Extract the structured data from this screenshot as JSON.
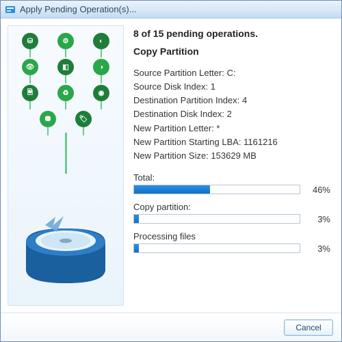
{
  "window": {
    "title": "Apply Pending Operation(s)..."
  },
  "operation": {
    "header": "8 of 15 pending operations.",
    "name": "Copy Partition",
    "details": {
      "source_partition_letter": "Source Partition Letter: C:",
      "source_disk_index": "Source Disk Index: 1",
      "destination_partition_index": "Destination Partition Index: 4",
      "destination_disk_index": "Destination Disk Index: 2",
      "new_partition_letter": "New Partition Letter: *",
      "new_partition_starting_lba": "New Partition Starting LBA: 1161216",
      "new_partition_size": "New Partition Size: 153629 MB"
    }
  },
  "progress": {
    "total": {
      "label": "Total:",
      "percent": 46,
      "text": "46%"
    },
    "copy": {
      "label": "Copy partition:",
      "percent": 3,
      "text": "3%"
    },
    "processing": {
      "label": "Processing files",
      "percent": 3,
      "text": "3%"
    }
  },
  "buttons": {
    "cancel": "Cancel"
  },
  "colors": {
    "accent": "#1470c4",
    "leaf": "#2aa74a"
  }
}
